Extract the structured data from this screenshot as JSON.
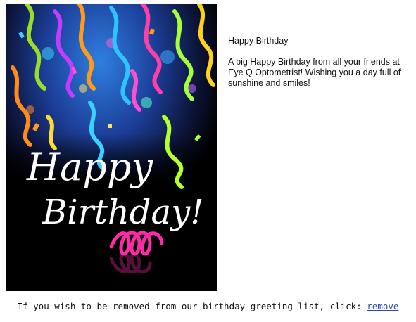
{
  "card": {
    "line1": "Happy",
    "line2": "Birthday!"
  },
  "message": {
    "title": "Happy Birthday",
    "body": "A big Happy Birthday from all your friends at Eye Q Optometrist! Wishing you a day full of sunshine and smiles!"
  },
  "footer": {
    "text": "If you wish to be removed from our birthday greeting list, click: ",
    "link_label": "remove"
  },
  "colors": {
    "link": "#2a4aa8",
    "card_background": "#000000"
  }
}
